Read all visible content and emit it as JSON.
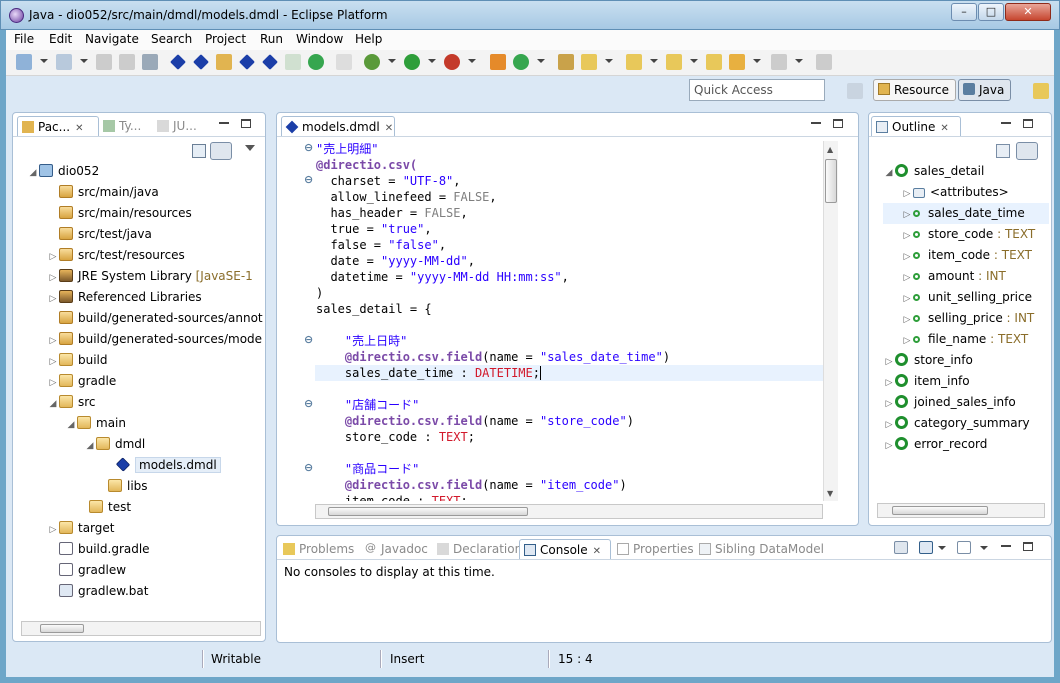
{
  "window": {
    "title": "Java - dio052/src/main/dmdl/models.dmdl - Eclipse Platform"
  },
  "menu": [
    "File",
    "Edit",
    "Navigate",
    "Search",
    "Project",
    "Run",
    "Window",
    "Help"
  ],
  "toolbar": {
    "quick_access_placeholder": "Quick Access",
    "perspectives": [
      "Resource",
      "Java"
    ]
  },
  "explorer": {
    "tabs": [
      "Pac...",
      "Ty...",
      "JU..."
    ],
    "tree": [
      {
        "label": "dio052",
        "extra": ""
      },
      {
        "label": "src/main/java",
        "extra": ""
      },
      {
        "label": "src/main/resources",
        "extra": ""
      },
      {
        "label": "src/test/java",
        "extra": ""
      },
      {
        "label": "src/test/resources",
        "extra": ""
      },
      {
        "label": "JRE System Library",
        "extra": "[JavaSE-1"
      },
      {
        "label": "Referenced Libraries",
        "extra": ""
      },
      {
        "label": "build/generated-sources/annot",
        "extra": ""
      },
      {
        "label": "build/generated-sources/mode",
        "extra": ""
      },
      {
        "label": "build",
        "extra": ""
      },
      {
        "label": "gradle",
        "extra": ""
      },
      {
        "label": "src",
        "extra": ""
      },
      {
        "label": "main",
        "extra": ""
      },
      {
        "label": "dmdl",
        "extra": ""
      },
      {
        "label": "models.dmdl",
        "extra": ""
      },
      {
        "label": "libs",
        "extra": ""
      },
      {
        "label": "test",
        "extra": ""
      },
      {
        "label": "target",
        "extra": ""
      },
      {
        "label": "build.gradle",
        "extra": ""
      },
      {
        "label": "gradlew",
        "extra": ""
      },
      {
        "label": "gradlew.bat",
        "extra": ""
      }
    ]
  },
  "editor": {
    "tab": "models.dmdl",
    "lines": [
      {
        "t": "\"売上明細\""
      },
      {
        "t": "@directio.csv("
      },
      {
        "t": "  charset = \"UTF-8\","
      },
      {
        "t": "  allow_linefeed = FALSE,"
      },
      {
        "t": "  has_header = FALSE,"
      },
      {
        "t": "  true = \"true\","
      },
      {
        "t": "  false = \"false\","
      },
      {
        "t": "  date = \"yyyy-MM-dd\","
      },
      {
        "t": "  datetime = \"yyyy-MM-dd HH:mm:ss\","
      },
      {
        "t": ")"
      },
      {
        "t": "sales_detail = {"
      },
      {
        "t": ""
      },
      {
        "t": "    \"売上日時\""
      },
      {
        "t": "    @directio.csv.field(name = \"sales_date_time\")"
      },
      {
        "t": "    sales_date_time : DATETIME;"
      },
      {
        "t": ""
      },
      {
        "t": "    \"店舗コード\""
      },
      {
        "t": "    @directio.csv.field(name = \"store_code\")"
      },
      {
        "t": "    store_code : TEXT;"
      },
      {
        "t": ""
      },
      {
        "t": "    \"商品コード\""
      },
      {
        "t": "    @directio.csv.field(name = \"item_code\")"
      },
      {
        "t": "    item_code : TEXT;"
      }
    ]
  },
  "outline": {
    "tab": "Outline",
    "items": [
      {
        "label": "sales_detail",
        "type": ""
      },
      {
        "label": "<attributes>",
        "type": ""
      },
      {
        "label": "sales_date_time",
        "type": ""
      },
      {
        "label": "store_code",
        "type": " : TEXT"
      },
      {
        "label": "item_code",
        "type": " : TEXT"
      },
      {
        "label": "amount",
        "type": " : INT"
      },
      {
        "label": "unit_selling_price",
        "type": ""
      },
      {
        "label": "selling_price",
        "type": " : INT"
      },
      {
        "label": "file_name",
        "type": " : TEXT"
      },
      {
        "label": "store_info",
        "type": ""
      },
      {
        "label": "item_info",
        "type": ""
      },
      {
        "label": "joined_sales_info",
        "type": ""
      },
      {
        "label": "category_summary",
        "type": ""
      },
      {
        "label": "error_record",
        "type": ""
      }
    ]
  },
  "bottom": {
    "tabs": [
      "Problems",
      "Javadoc",
      "Declaration",
      "Console",
      "Properties",
      "Sibling DataModel"
    ],
    "message": "No consoles to display at this time."
  },
  "status": {
    "mode": "Writable",
    "insert": "Insert",
    "position": "15 : 4"
  },
  "colors": {
    "frame": "#dbe8f5",
    "keyword": "#7f0055",
    "string": "#2a00ff",
    "type": "#d2192b"
  }
}
